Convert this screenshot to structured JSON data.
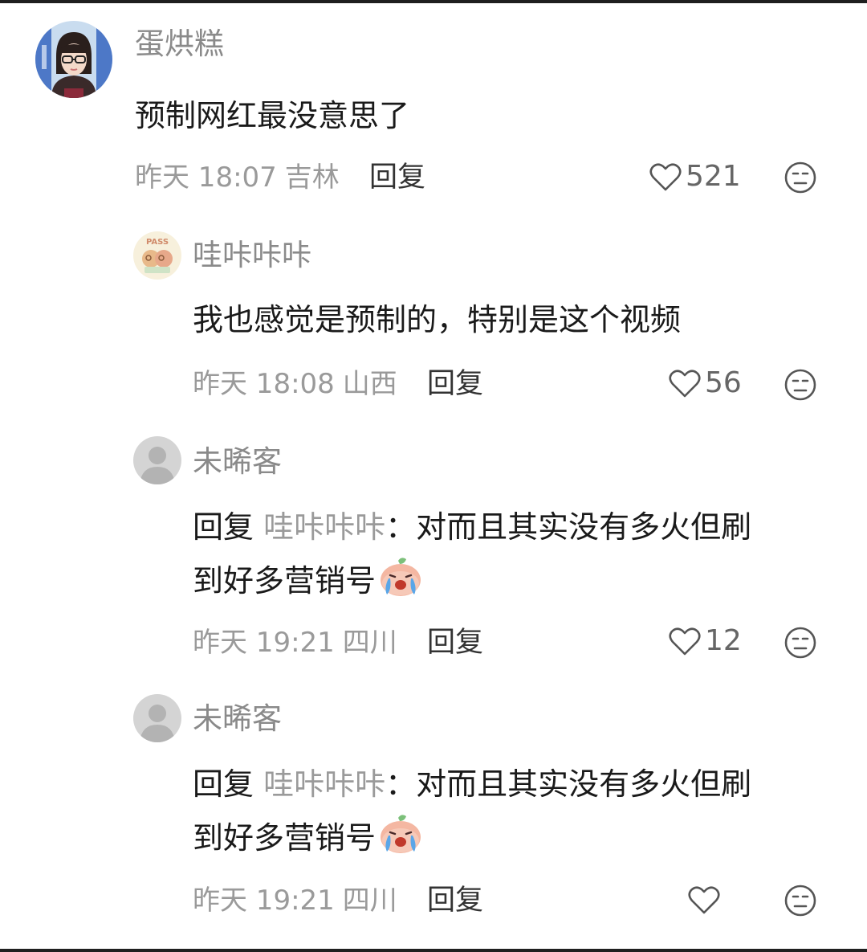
{
  "comments": [
    {
      "username": "蛋烘糕",
      "content": "预制网红最没意思了",
      "time": "昨天 18:07",
      "location": "吉林",
      "reply_label": "回复",
      "likes": "521",
      "avatar_icon": "user-photo-avatar"
    },
    {
      "username": "哇咔咔咔",
      "content": "我也感觉是预制的，特别是这个视频",
      "time": "昨天 18:08",
      "location": "山西",
      "reply_label": "回复",
      "likes": "56",
      "avatar_icon": "pass-sticker-avatar"
    },
    {
      "username": "未晞客",
      "reply_prefix": "回复",
      "reply_to": "哇咔咔咔",
      "separator": "：",
      "content_line1": "对而且其实没有多火但刷",
      "content_line2": "到好多营销号",
      "emoji_icon": "crying-peach-emoji",
      "time": "昨天 19:21",
      "location": "四川",
      "reply_label": "回复",
      "likes": "12",
      "avatar_icon": "default-gray-avatar"
    },
    {
      "username": "未晞客",
      "reply_prefix": "回复",
      "reply_to": "哇咔咔咔",
      "separator": "：",
      "content_line1": "对而且其实没有多火但刷",
      "content_line2": "到好多营销号",
      "emoji_icon": "crying-peach-emoji",
      "time": "昨天 19:21",
      "location": "四川",
      "reply_label": "回复",
      "likes": "",
      "avatar_icon": "default-gray-avatar"
    }
  ],
  "colors": {
    "username": "#8a8a8a",
    "content": "#1a1a1a",
    "meta": "#9a9a9a",
    "reply_target": "#9a9a9a"
  }
}
